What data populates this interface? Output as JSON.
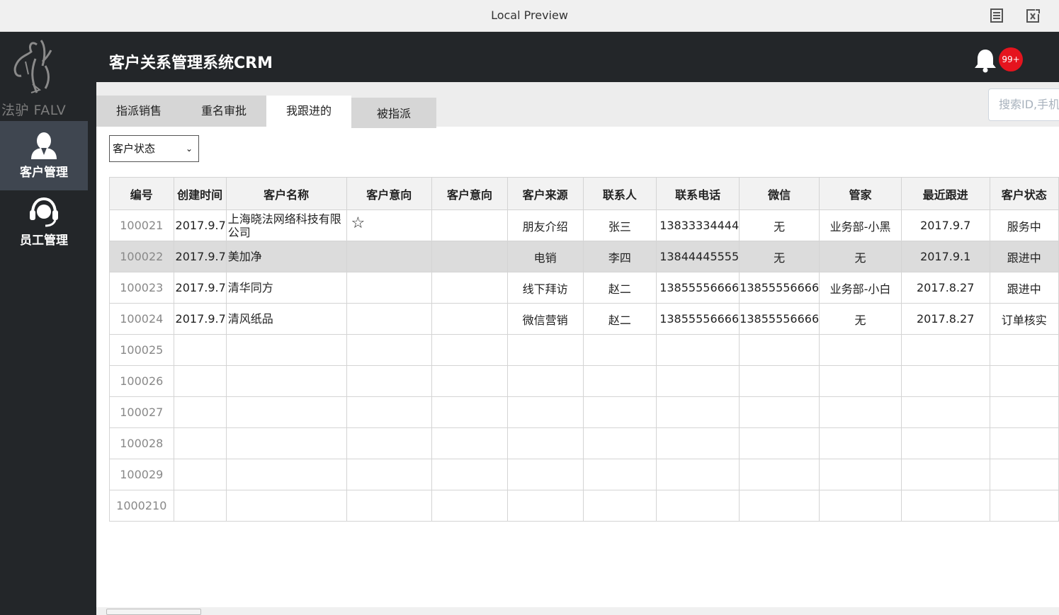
{
  "window": {
    "title": "Local Preview"
  },
  "brand": {
    "logo_text": "法驴 FALV"
  },
  "sidebar": {
    "items": [
      {
        "label": "客户管理",
        "icon": "user-icon",
        "active": true
      },
      {
        "label": "员工管理",
        "icon": "headset-icon",
        "active": false
      }
    ]
  },
  "header": {
    "title": "客户关系管理系统CRM",
    "notification_count": "99+"
  },
  "tabs": [
    {
      "label": "指派销售",
      "active": false
    },
    {
      "label": "重名审批",
      "active": false
    },
    {
      "label": "我跟进的",
      "active": true
    },
    {
      "label": "被指派",
      "active": false
    }
  ],
  "search": {
    "placeholder": "搜索ID,手机"
  },
  "filter": {
    "selected": "客户状态"
  },
  "table": {
    "columns": [
      "编号",
      "创建时间",
      "客户名称",
      "客户意向",
      "客户意向",
      "客户来源",
      "联系人",
      "联系电话",
      "微信",
      "管家",
      "最近跟进",
      "客户状态"
    ],
    "rows": [
      [
        "100021",
        "2017.9.7",
        "上海晓法网络科技有限公司",
        "☆",
        "",
        "朋友介绍",
        "张三",
        "13833334444",
        "无",
        "业务部-小黑",
        "2017.9.7",
        "服务中"
      ],
      [
        "100022",
        "2017.9.7",
        "美加净",
        "",
        "",
        "电销",
        "李四",
        "13844445555",
        "无",
        "无",
        "2017.9.1",
        "跟进中"
      ],
      [
        "100023",
        "2017.9.7",
        "清华同方",
        "",
        "",
        "线下拜访",
        "赵二",
        "13855556666",
        "13855556666",
        "业务部-小白",
        "2017.8.27",
        "跟进中"
      ],
      [
        "100024",
        "2017.9.7",
        "清风纸品",
        "",
        "",
        "微信营销",
        "赵二",
        "13855556666",
        "13855556666",
        "无",
        "2017.8.27",
        "订单核实"
      ],
      [
        "100025",
        "",
        "",
        "",
        "",
        "",
        "",
        "",
        "",
        "",
        "",
        ""
      ],
      [
        "100026",
        "",
        "",
        "",
        "",
        "",
        "",
        "",
        "",
        "",
        "",
        ""
      ],
      [
        "100027",
        "",
        "",
        "",
        "",
        "",
        "",
        "",
        "",
        "",
        "",
        ""
      ],
      [
        "100028",
        "",
        "",
        "",
        "",
        "",
        "",
        "",
        "",
        "",
        "",
        ""
      ],
      [
        "100029",
        "",
        "",
        "",
        "",
        "",
        "",
        "",
        "",
        "",
        "",
        ""
      ],
      [
        "1000210",
        "",
        "",
        "",
        "",
        "",
        "",
        "",
        "",
        "",
        "",
        ""
      ]
    ],
    "selected_row": 1
  },
  "colors": {
    "sidebar_bg": "#232629",
    "active_nav": "#3f4650",
    "badge": "#e5141e"
  }
}
